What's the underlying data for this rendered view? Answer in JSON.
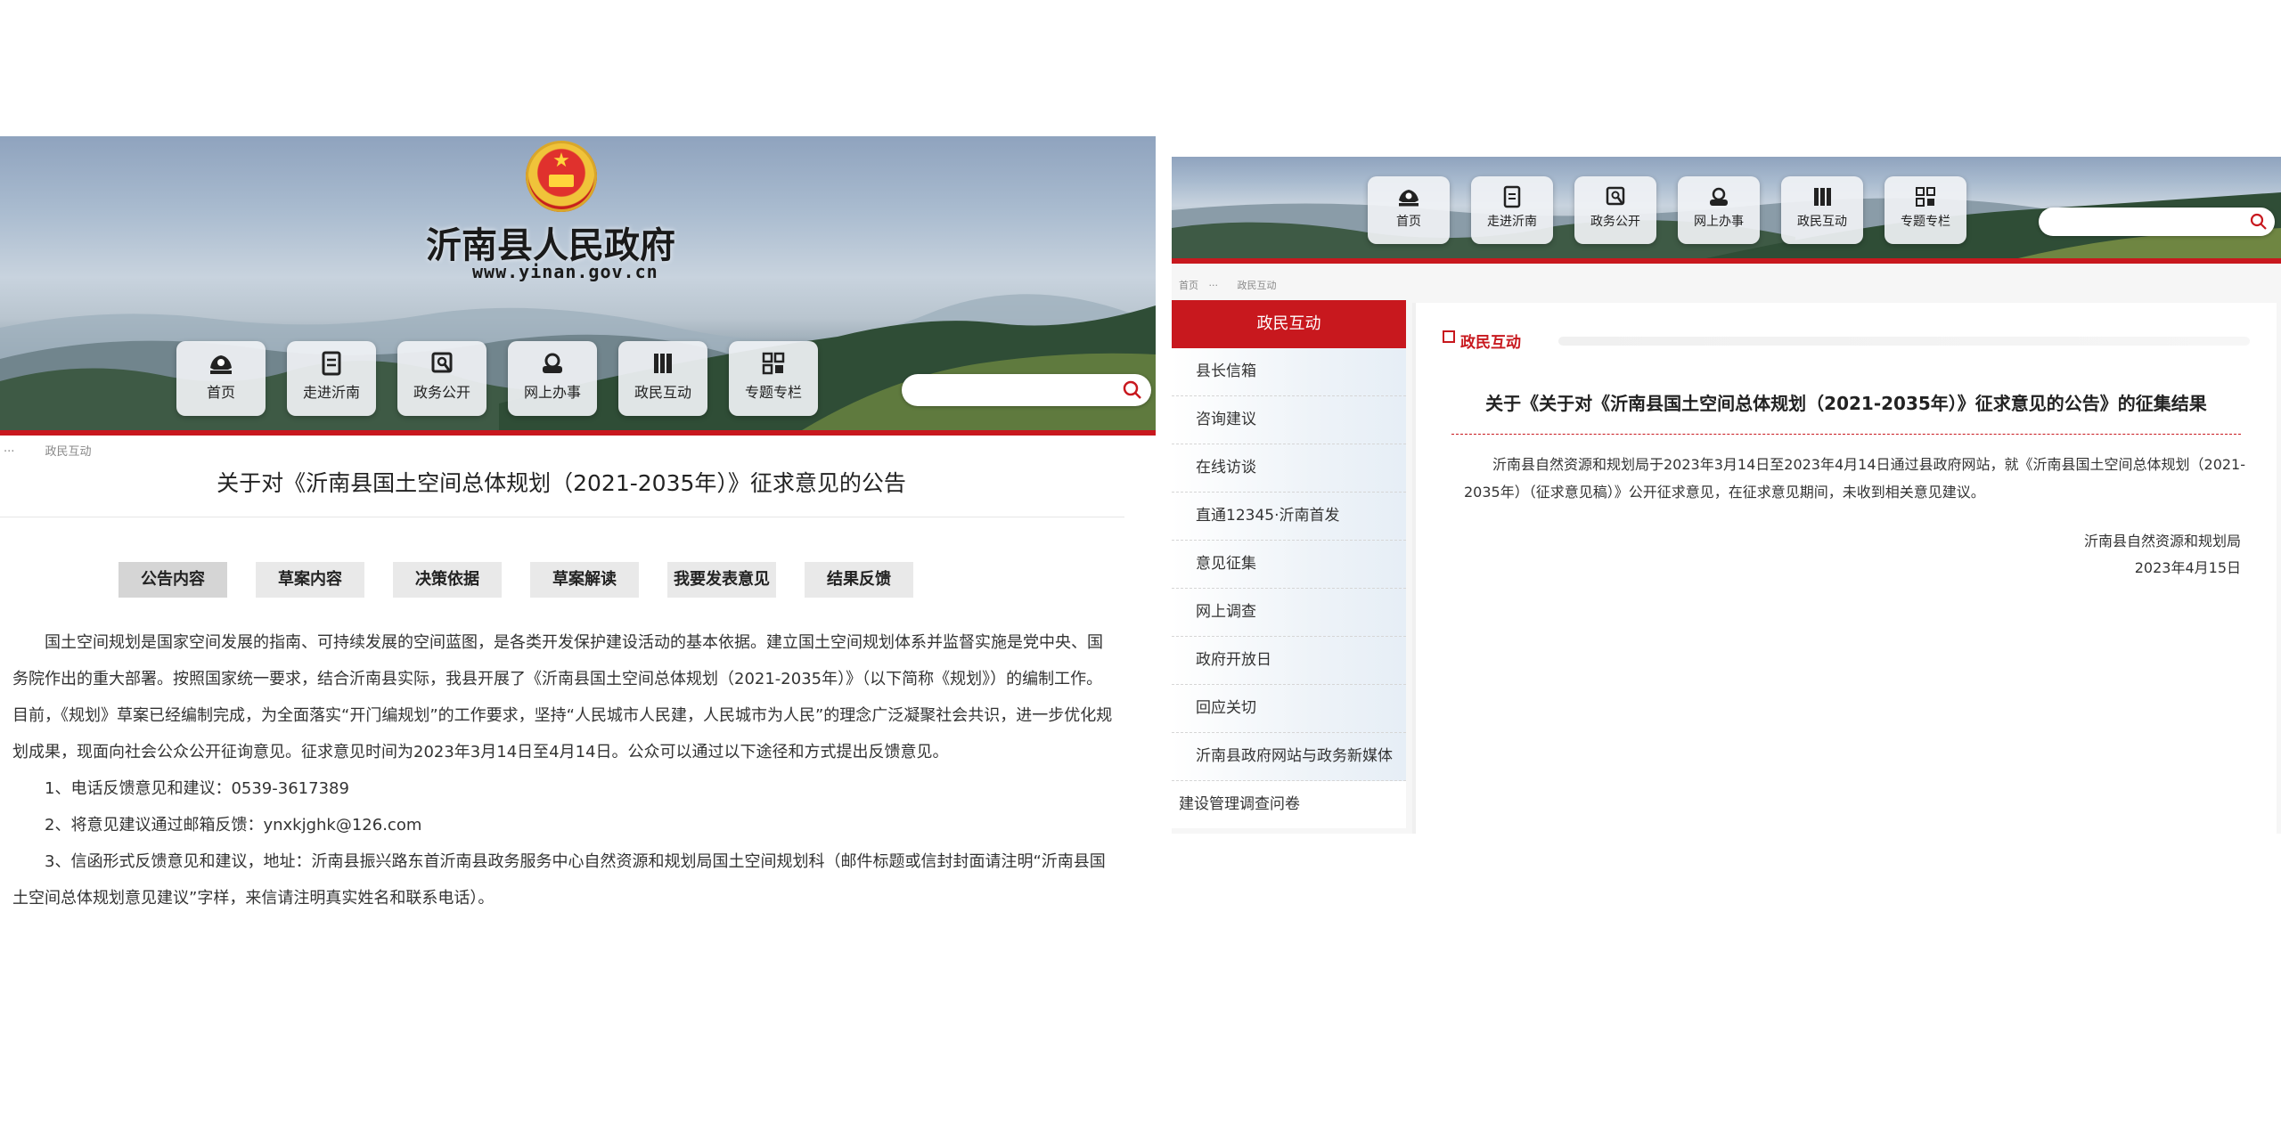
{
  "left": {
    "site_name": "沂南县人民政府",
    "site_url": "www.yinan.gov.cn",
    "nav": [
      {
        "label": "首页",
        "icon": "home-icon"
      },
      {
        "label": "走进沂南",
        "icon": "document-icon"
      },
      {
        "label": "政务公开",
        "icon": "open-gov-icon"
      },
      {
        "label": "网上办事",
        "icon": "online-service-icon"
      },
      {
        "label": "政民互动",
        "icon": "books-icon"
      },
      {
        "label": "专题专栏",
        "icon": "qr-grid-icon"
      }
    ],
    "search_placeholder": "",
    "breadcrumb": {
      "sep": "···",
      "current": "政民互动"
    },
    "title": "关于对《沂南县国土空间总体规划（2021-2035年）》征求意见的公告",
    "tabs": [
      "公告内容",
      "草案内容",
      "决策依据",
      "草案解读",
      "我要发表意见",
      "结果反馈"
    ],
    "paragraphs": [
      "国土空间规划是国家空间发展的指南、可持续发展的空间蓝图，是各类开发保护建设活动的基本依据。建立国土空间规划体系并监督实施是党中央、国务院作出的重大部署。按照国家统一要求，结合沂南县实际，我县开展了《沂南县国土空间总体规划（2021-2035年）》（以下简称《规划》）的编制工作。目前，《规划》草案已经编制完成，为全面落实“开门编规划”的工作要求，坚持“人民城市人民建，人民城市为人民”的理念广泛凝聚社会共识，进一步优化规划成果，现面向社会公众公开征询意见。征求意见时间为2023年3月14日至4月14日。公众可以通过以下途径和方式提出反馈意见。",
      "1、电话反馈意见和建议：0539-3617389",
      "2、将意见建议通过邮箱反馈：ynxkjghk@126.com",
      "3、信函形式反馈意见和建议，地址：沂南县振兴路东首沂南县政务服务中心自然资源和规划局国土空间规划科（邮件标题或信封封面请注明“沂南县国土空间总体规划意见建议”字样，来信请注明真实姓名和联系电话）。"
    ]
  },
  "right": {
    "nav": [
      {
        "label": "首页",
        "icon": "home-icon"
      },
      {
        "label": "走进沂南",
        "icon": "document-icon"
      },
      {
        "label": "政务公开",
        "icon": "open-gov-icon"
      },
      {
        "label": "网上办事",
        "icon": "online-service-icon"
      },
      {
        "label": "政民互动",
        "icon": "books-icon"
      },
      {
        "label": "专题专栏",
        "icon": "qr-grid-icon"
      }
    ],
    "search_placeholder": "",
    "breadcrumb": {
      "home": "首页",
      "sep": "···",
      "current": "政民互动"
    },
    "sidebar_title": "政民互动",
    "sidebar_items": [
      "县长信箱",
      "咨询建议",
      "在线访谈",
      "直通12345·沂南首发",
      "意见征集",
      "网上调查",
      "政府开放日",
      "回应关切",
      "沂南县政府网站与政务新媒体",
      "建设管理调查问卷"
    ],
    "section_title": "政民互动",
    "article_title": "关于《关于对《沂南县国土空间总体规划（2021-2035年）》征求意见的公告》的征集结果",
    "article_text": "沂南县自然资源和规划局于2023年3月14日至2023年4月14日通过县政府网站，就《沂南县国土空间总体规划（2021-2035年）（征求意见稿）》公开征求意见，在征求意见期间，未收到相关意见建议。",
    "signature": "沂南县自然资源和规划局",
    "date": "2023年4月15日"
  },
  "colors": {
    "brand_red": "#c8181e",
    "tab_bg": "#e9e9e9",
    "sidebar_blue": "#e6eef6"
  }
}
